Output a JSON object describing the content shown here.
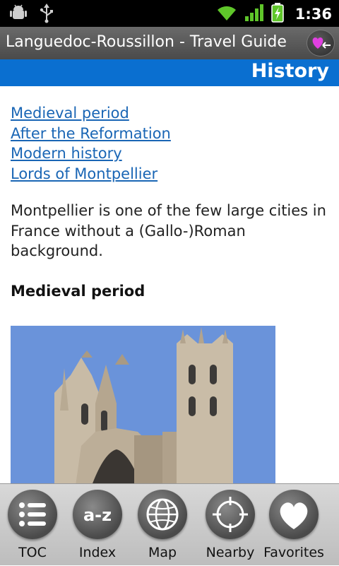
{
  "status_bar": {
    "time": "1:36",
    "icons": [
      "android-debug-icon",
      "usb-icon",
      "wifi-icon",
      "signal-icon",
      "battery-charging-icon"
    ]
  },
  "header": {
    "title": "Languedoc-Roussillon - Travel Guide",
    "favorites_icon": "heart-back-icon"
  },
  "section": {
    "title": "History"
  },
  "toc_links": [
    "Medieval period",
    "After the Reformation",
    "Modern history",
    "Lords of Montpellier"
  ],
  "intro_text": "Montpellier is one of the few large cities in France without a (Gallo-)Roman background.",
  "subheading": "Medieval period",
  "colors": {
    "link": "#1a66b5",
    "section_header": "#0a6fd0",
    "title_bar": "#555555",
    "sky": "#5f8cd6"
  },
  "bottom_nav": [
    {
      "label": "TOC",
      "icon": "list-icon"
    },
    {
      "label": "Index",
      "icon": "a-z-icon"
    },
    {
      "label": "Map",
      "icon": "globe-icon"
    },
    {
      "label": "Nearby",
      "icon": "crosshair-icon"
    },
    {
      "label": "Favorites",
      "icon": "heart-icon"
    }
  ]
}
